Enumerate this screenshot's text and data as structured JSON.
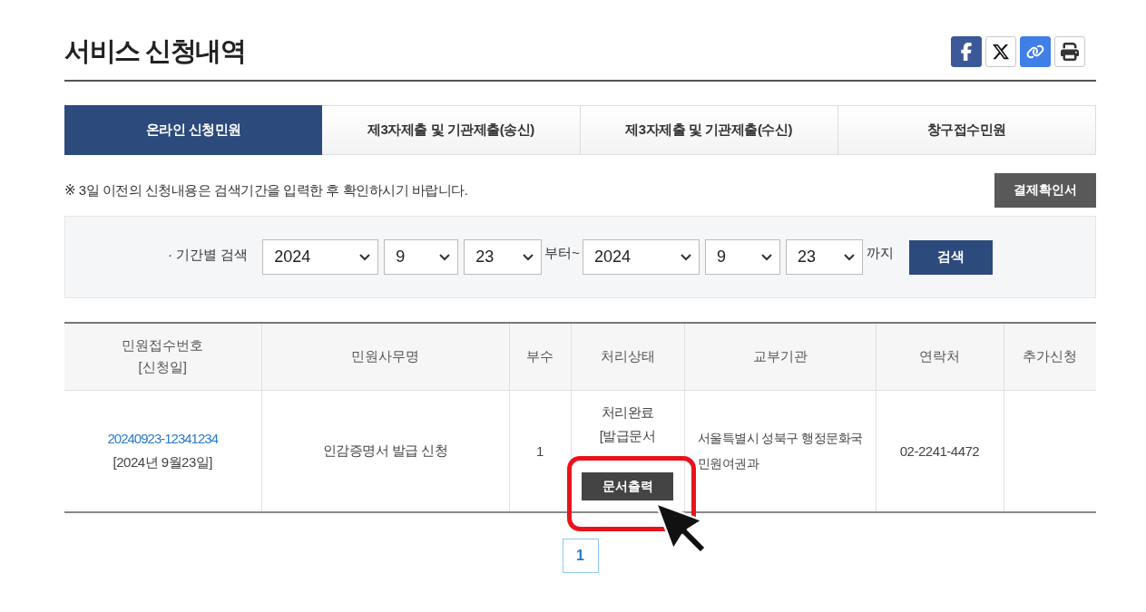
{
  "page": {
    "title": "서비스 신청내역"
  },
  "tabs": [
    {
      "label": "온라인 신청민원",
      "selected": true
    },
    {
      "label": "제3자제출 및 기관제출(송신)",
      "selected": false
    },
    {
      "label": "제3자제출 및 기관제출(수신)",
      "selected": false
    },
    {
      "label": "창구접수민원",
      "selected": false
    }
  ],
  "notice": {
    "text": "※ 3일 이전의 신청내용은 검색기간을 입력한 후 확인하시기 바랍니다.",
    "button": "결제확인서"
  },
  "search": {
    "label": "· 기간별 검색",
    "from": [
      {
        "kind": "year",
        "value": "2024"
      },
      {
        "kind": "month",
        "value": "9"
      },
      {
        "kind": "day",
        "value": "23"
      }
    ],
    "from_suffix": "부터~",
    "to": [
      {
        "kind": "year",
        "value": "2024"
      },
      {
        "kind": "month",
        "value": "9"
      },
      {
        "kind": "day",
        "value": "23"
      }
    ],
    "to_suffix": "까지",
    "button": "검색"
  },
  "table": {
    "columns": [
      {
        "label": "민원접수번호",
        "sublabel": "[신청일]"
      },
      {
        "label": "민원사무명"
      },
      {
        "label": "부수"
      },
      {
        "label": "처리상태"
      },
      {
        "label": "교부기관"
      },
      {
        "label": "연락처"
      },
      {
        "label": "추가신청"
      }
    ],
    "rows": [
      {
        "receipt_no": "20240923-12341234",
        "date": "[2024년 9월23일]",
        "service": "인감증명서 발급 신청",
        "copies": "1",
        "status": [
          "처리완료",
          "[발급문서"
        ],
        "status_button": "문서출력",
        "office": "서울특별시 성북구 행정문화국 민원여권과",
        "phone": "02-2241-4472"
      }
    ]
  },
  "pagination": [
    {
      "label": "1",
      "selected": true
    }
  ]
}
